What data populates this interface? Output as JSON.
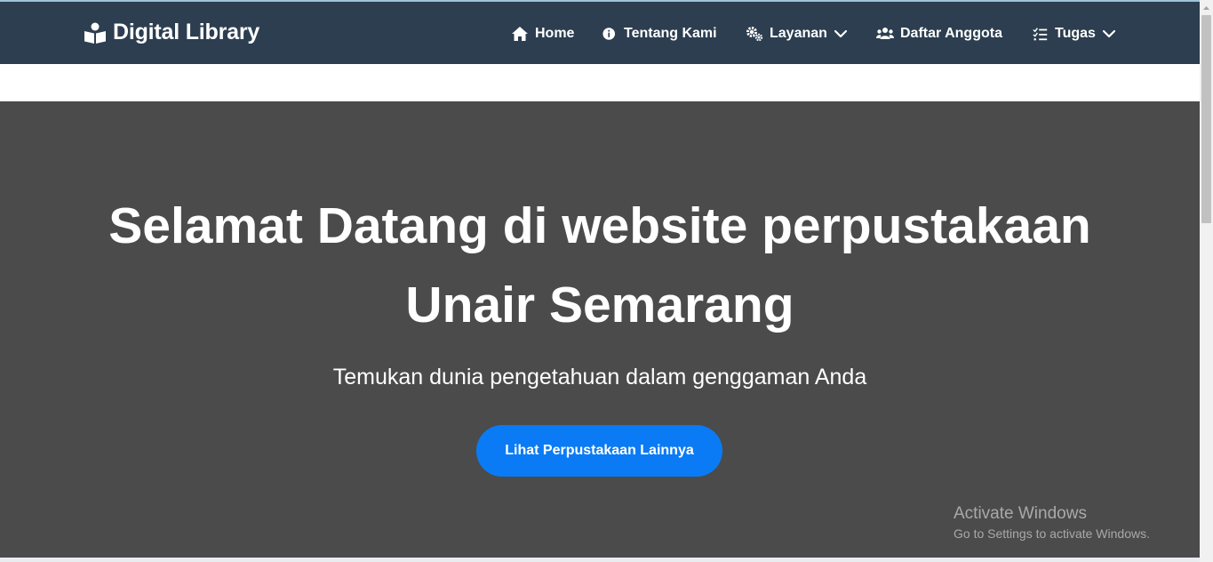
{
  "navbar": {
    "brand": {
      "label": "Digital Library",
      "icon": "book-reader-icon"
    },
    "items": [
      {
        "label": "Home",
        "icon": "home-icon",
        "dropdown": false
      },
      {
        "label": "Tentang Kami",
        "icon": "info-circle-icon",
        "dropdown": false
      },
      {
        "label": "Layanan",
        "icon": "gears-icon",
        "dropdown": true
      },
      {
        "label": "Daftar Anggota",
        "icon": "users-icon",
        "dropdown": false
      },
      {
        "label": "Tugas",
        "icon": "list-check-icon",
        "dropdown": true
      }
    ],
    "background": "#2c3e50"
  },
  "hero": {
    "title_line1": "Selamat Datang di website perpustakaan",
    "title_line2": "Unair Semarang",
    "subtitle": "Temukan dunia pengetahuan dalam genggaman Anda",
    "button_label": "Lihat Perpustakaan Lainnya",
    "background": "#4b4b4b",
    "button_color": "#0a7bf5"
  },
  "watermark": {
    "title": "Activate Windows",
    "subtitle": "Go to Settings to activate Windows."
  }
}
